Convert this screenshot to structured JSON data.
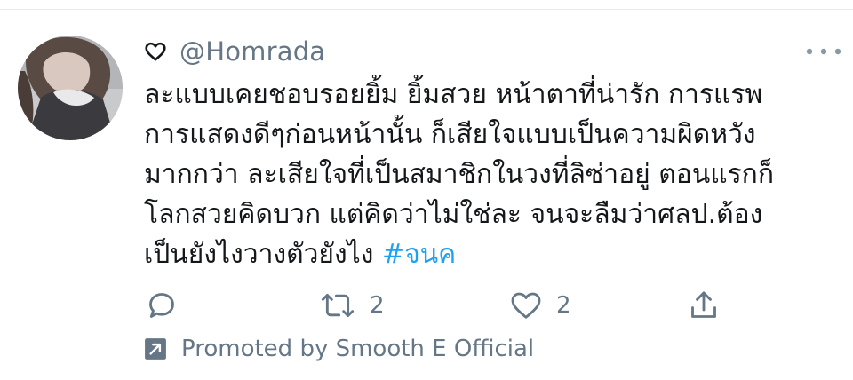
{
  "tweet": {
    "handle": "@Homrada",
    "lines": [
      "ละแบบเคยชอบรอยยิ้ม ยิ้มสวย หน้าตาที่น่ารัก การแรพ",
      "การแสดงดีๆก่อนหน้านั้น ก็เสียใจแบบเป็นความผิดหวัง",
      "มากกว่า ละเสียใจที่เป็นสมาชิกในวงที่ลิซ่าอยู่ ตอนแรกก็",
      "โลกสวยคิดบวก แต่คิดว่าไม่ใช่ละ จนจะลืมว่าศลป.ต้อง",
      "เป็นยังไงวางตัวยังไง"
    ],
    "hashtag": "#จนค",
    "icons": {
      "name_prefix": "heart-outline-icon",
      "more": "more-horizontal-icon"
    }
  },
  "actions": {
    "reply": {
      "icon": "reply-icon"
    },
    "retweet": {
      "icon": "retweet-icon",
      "count": "2"
    },
    "like": {
      "icon": "heart-icon",
      "count": "2"
    },
    "share": {
      "icon": "share-icon"
    }
  },
  "promoted": {
    "icon": "promoted-arrow-icon",
    "text": "Promoted by Smooth E Official"
  },
  "colors": {
    "text": "#14171a",
    "secondary": "#657786",
    "hashtag": "#1da1f2",
    "divider": "#e6ecf0"
  }
}
